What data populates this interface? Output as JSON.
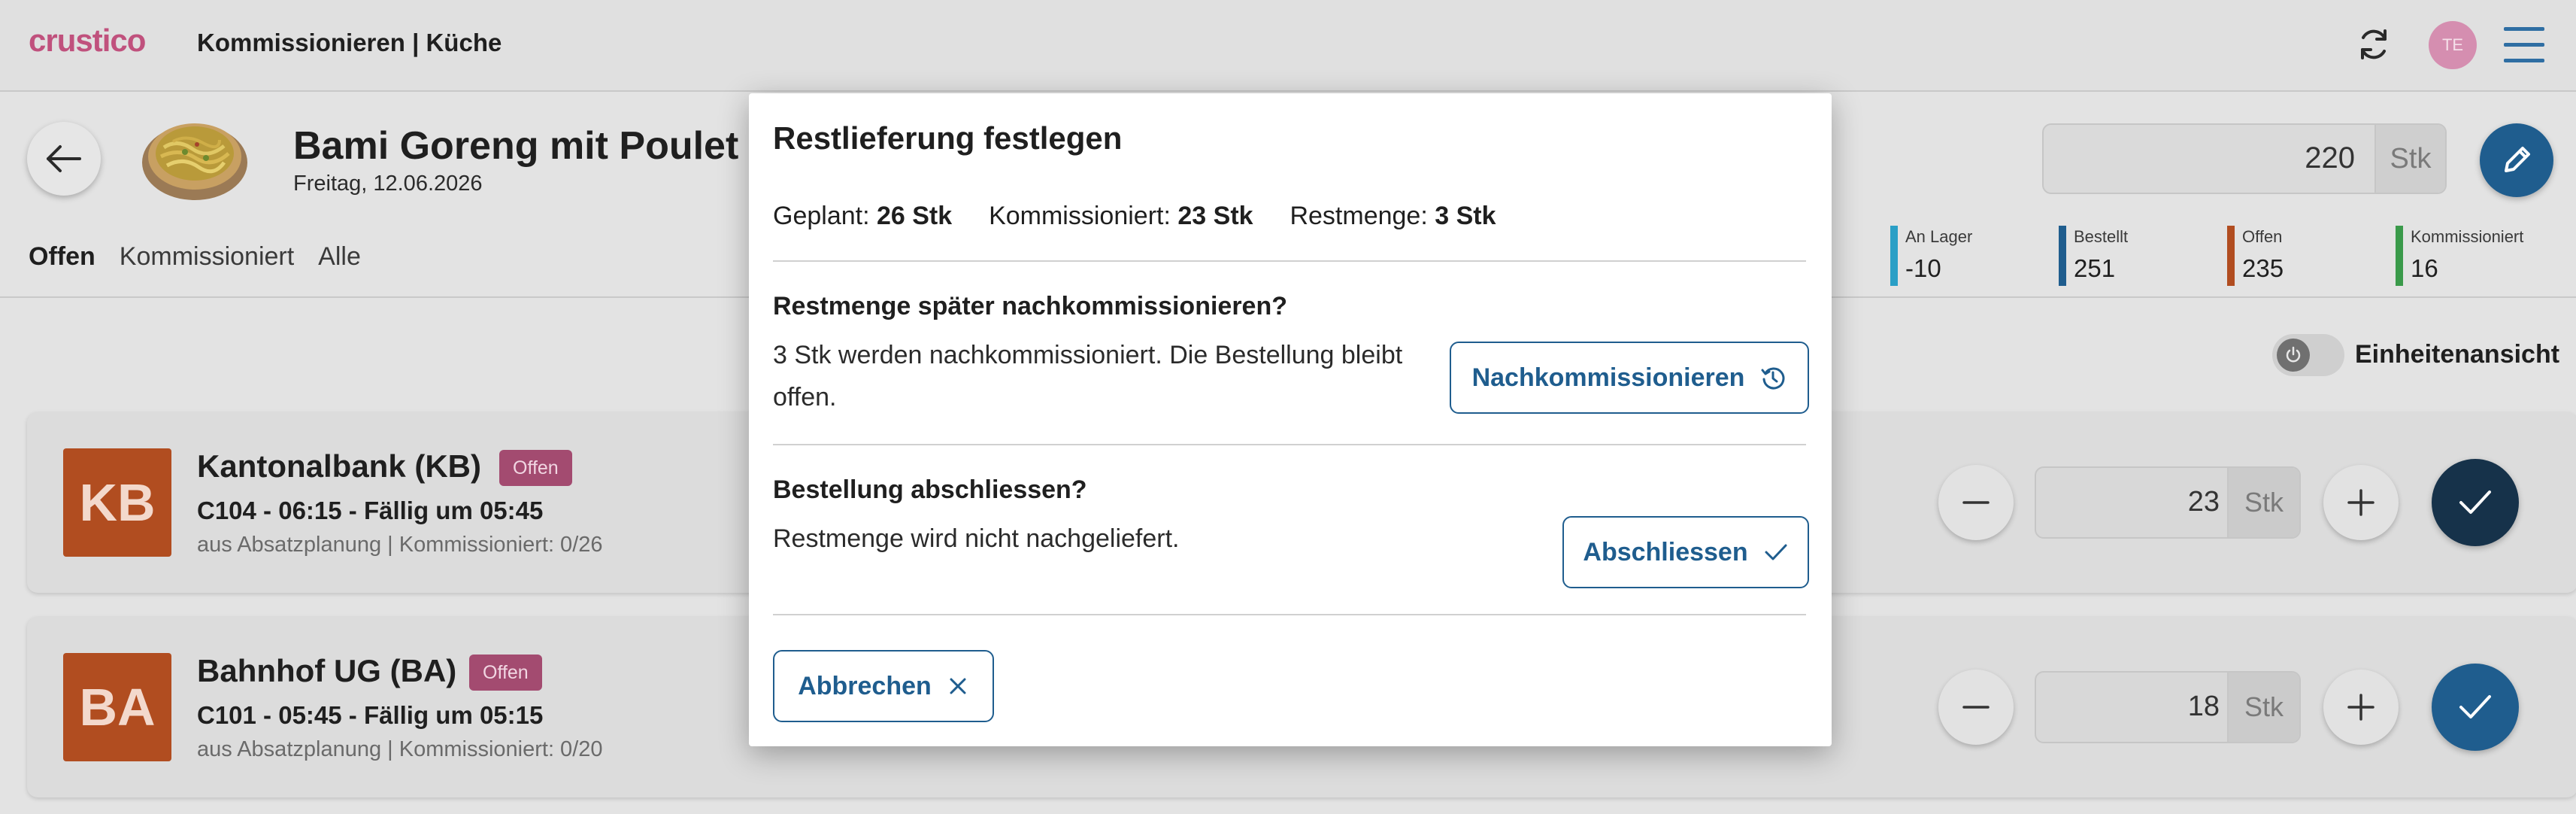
{
  "app": {
    "logo": "crustico",
    "title": "Kommissionieren | Küche",
    "avatar_initials": "TE"
  },
  "header": {
    "dish_title": "Bami Goreng mit Poulet",
    "date": "Freitag, 12.06.2026",
    "quantity": "220",
    "quantity_unit": "Stk",
    "tabs": [
      {
        "label": "Offen",
        "active": true
      },
      {
        "label": "Kommissioniert",
        "active": false
      },
      {
        "label": "Alle",
        "active": false
      }
    ],
    "stats": [
      {
        "label": "An Lager",
        "value": "-10",
        "color": "#2a9fc6"
      },
      {
        "label": "Bestellt",
        "value": "251",
        "color": "#1f5d8e"
      },
      {
        "label": "Offen",
        "value": "235",
        "color": "#b14d20"
      },
      {
        "label": "Kommissioniert",
        "value": "16",
        "color": "#3a9a4a"
      }
    ]
  },
  "content": {
    "unit_view_label": "Einheitenansicht",
    "orders": [
      {
        "initials": "KB",
        "name": "Kantonalbank (KB)",
        "status": "Offen",
        "slot": "C104 - 06:15 - Fällig um 05:45",
        "meta": "aus Absatzplanung | Kommissioniert: 0/26",
        "quantity": "23",
        "unit": "Stk",
        "check_color": "#16324a"
      },
      {
        "initials": "BA",
        "name": "Bahnhof UG (BA)",
        "status": "Offen",
        "slot": "C101 - 05:45 - Fällig um 05:15",
        "meta": "aus Absatzplanung | Kommissioniert: 0/20",
        "quantity": "18",
        "unit": "Stk",
        "check_color": "#1f5d8e"
      }
    ]
  },
  "modal": {
    "title": "Restlieferung festlegen",
    "summary": {
      "planned_label": "Geplant:",
      "planned_value": "26 Stk",
      "picked_label": "Kommissioniert:",
      "picked_value": "23 Stk",
      "rest_label": "Restmenge:",
      "rest_value": "3 Stk"
    },
    "later": {
      "title": "Restmenge später nachkommissionieren?",
      "text": "3 Stk werden nachkommissioniert. Die Bestellung bleibt offen.",
      "button": "Nachkommissionieren"
    },
    "close": {
      "title": "Bestellung abschliessen?",
      "text": "Restmenge wird nicht nachgeliefert.",
      "button": "Abschliessen"
    },
    "cancel_button": "Abbrechen"
  },
  "colors": {
    "brand": "#c0517d",
    "primary": "#1f5d8e",
    "status_badge": "#a34b70",
    "initials_bg": "#b14d20"
  }
}
